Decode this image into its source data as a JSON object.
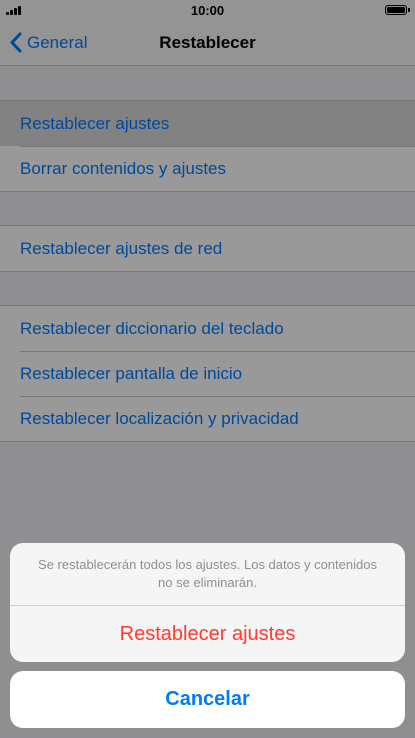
{
  "status_bar": {
    "time": "10:00"
  },
  "nav": {
    "back_label": "General",
    "title": "Restablecer"
  },
  "groups": [
    {
      "items": [
        {
          "label": "Restablecer ajustes"
        },
        {
          "label": "Borrar contenidos y ajustes"
        }
      ]
    },
    {
      "items": [
        {
          "label": "Restablecer ajustes de red"
        }
      ]
    },
    {
      "items": [
        {
          "label": "Restablecer diccionario del teclado"
        },
        {
          "label": "Restablecer pantalla de inicio"
        },
        {
          "label": "Restablecer localización y privacidad"
        }
      ]
    }
  ],
  "action_sheet": {
    "message": "Se restablecerán todos los ajustes. Los datos y contenidos no se eliminarán.",
    "destructive_label": "Restablecer ajustes",
    "cancel_label": "Cancelar"
  },
  "colors": {
    "accent": "#007aff",
    "destructive": "#ff3b30"
  }
}
